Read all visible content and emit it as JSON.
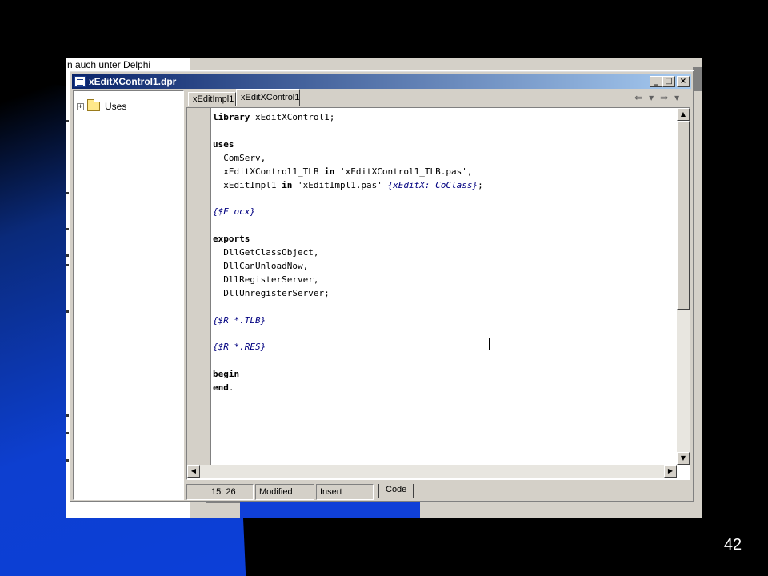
{
  "slide": {
    "page_number": "42"
  },
  "background_window": {
    "fragment_text": "n auch unter Delphi"
  },
  "window": {
    "title": "xEditXControl1.dpr",
    "buttons": {
      "minimize": "_",
      "maximize": "□",
      "close": "×"
    }
  },
  "tree": {
    "item_label": "Uses",
    "expander": "+"
  },
  "tabs": [
    {
      "label": "xEditImpl1"
    },
    {
      "label": "xEditXControl1"
    }
  ],
  "nav": {
    "back": "⇐",
    "back_menu": "▾",
    "forward": "⇒",
    "forward_menu": "▾"
  },
  "code": {
    "lines": [
      [
        {
          "t": "library",
          "s": "kw"
        },
        {
          "t": " xEditXControl1;"
        }
      ],
      [],
      [
        {
          "t": "uses",
          "s": "kw"
        }
      ],
      [
        {
          "t": "  ComServ,"
        }
      ],
      [
        {
          "t": "  xEditXControl1_TLB "
        },
        {
          "t": "in",
          "s": "kw"
        },
        {
          "t": " 'xEditXControl1_TLB.pas',"
        }
      ],
      [
        {
          "t": "  xEditImpl1 "
        },
        {
          "t": "in",
          "s": "kw"
        },
        {
          "t": " 'xEditImpl1.pas' "
        },
        {
          "t": "{xEditX: CoClass}",
          "s": "cm"
        },
        {
          "t": ";"
        }
      ],
      [],
      [
        {
          "t": "{$E ocx}",
          "s": "cm"
        }
      ],
      [],
      [
        {
          "t": "exports",
          "s": "kw"
        }
      ],
      [
        {
          "t": "  DllGetClassObject,"
        }
      ],
      [
        {
          "t": "  DllCanUnloadNow,"
        }
      ],
      [
        {
          "t": "  DllRegisterServer,"
        }
      ],
      [
        {
          "t": "  DllUnregisterServer;"
        }
      ],
      [],
      [
        {
          "t": "{$R *.TLB}",
          "s": "cm"
        }
      ],
      [],
      [
        {
          "t": "{$R *.RES}",
          "s": "cm"
        }
      ],
      [],
      [
        {
          "t": "begin",
          "s": "kw"
        }
      ],
      [
        {
          "t": "end",
          "s": "kw"
        },
        {
          "t": "."
        }
      ]
    ]
  },
  "scroll": {
    "up": "▲",
    "down": "▼",
    "left": "◀",
    "right": "▶"
  },
  "status": {
    "position": "15: 26",
    "modified": "Modified",
    "mode": "Insert",
    "code_tab": "Code"
  }
}
